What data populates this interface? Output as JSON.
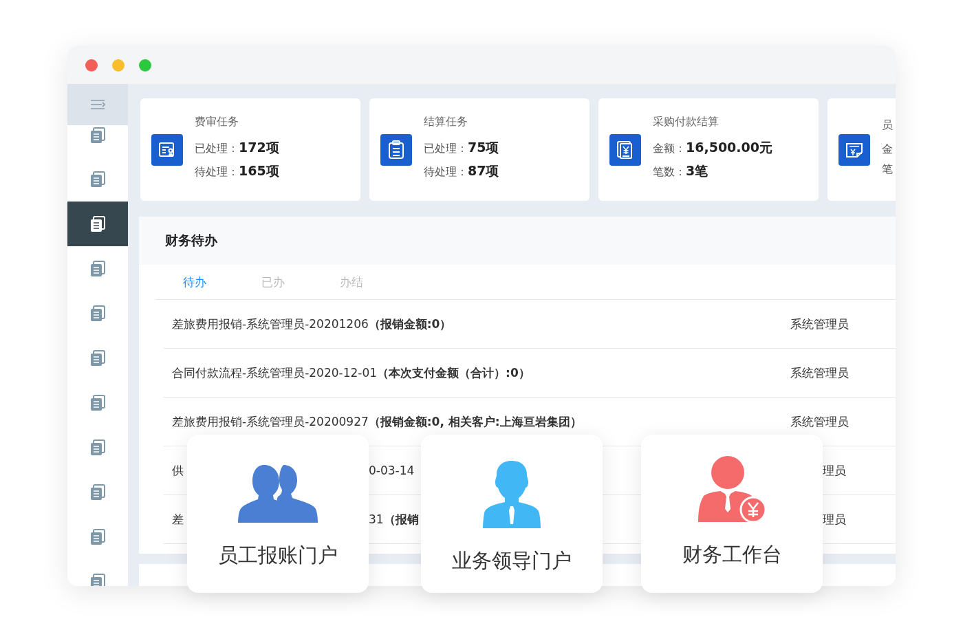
{
  "window": {
    "controls": [
      {
        "color": "#f25f58"
      },
      {
        "color": "#f9be2e"
      },
      {
        "color": "#2cc840"
      }
    ]
  },
  "sidebar": {
    "items": [
      {
        "selected": false
      },
      {
        "selected": false
      },
      {
        "selected": true
      },
      {
        "selected": false
      },
      {
        "selected": false
      },
      {
        "selected": false
      },
      {
        "selected": false
      },
      {
        "selected": false
      },
      {
        "selected": false
      },
      {
        "selected": false
      },
      {
        "selected": false
      }
    ]
  },
  "stats": [
    {
      "title": "费审任务",
      "kind": "review",
      "lines": [
        {
          "label": "已处理：",
          "value": "172项"
        },
        {
          "label": "待处理：",
          "value": "165项"
        }
      ]
    },
    {
      "title": "结算任务",
      "kind": "clipboard",
      "lines": [
        {
          "label": "已处理：",
          "value": "75项"
        },
        {
          "label": "待处理：",
          "value": "87项"
        }
      ]
    },
    {
      "title": "采购付款结算",
      "kind": "payment",
      "lines": [
        {
          "label": "金额：",
          "value": "16,500.00元"
        },
        {
          "label": "笔数：",
          "value": "3笔"
        }
      ]
    },
    {
      "title": "员",
      "kind": "expense",
      "lines": [
        {
          "label": "金"
        },
        {
          "label": "笔"
        }
      ]
    }
  ],
  "todo": {
    "title": "财务待办",
    "tabs": [
      {
        "label": "待办",
        "selected": true
      },
      {
        "label": "已办",
        "selected": false
      },
      {
        "label": "办结",
        "selected": false
      }
    ],
    "rows": [
      {
        "kind": "full",
        "title": "差旅费用报销-系统管理员-20201206**（报销金额:0）**",
        "owner": "系统管理员"
      },
      {
        "kind": "full",
        "title": "合同付款流程-系统管理员-2020-12-01**（本次支付金额（合计）:0）**",
        "owner": "系统管理员"
      },
      {
        "kind": "full",
        "title": "差旅费用报销-系统管理员-20200927**（报销金额:0, 相关客户:上海亘岩集团）**",
        "owner": "系统管理员"
      },
      {
        "kind": "partial",
        "fragments": [
          "供",
          "0-03-14",
          "理员"
        ]
      },
      {
        "kind": "partial",
        "fragments": [
          "差",
          "31**（报销**",
          "理员"
        ]
      }
    ]
  },
  "portals": [
    {
      "title": "员工报账门户",
      "kind": "employee"
    },
    {
      "title": "业务领导门户",
      "kind": "leader"
    },
    {
      "title": "财务工作台",
      "kind": "finance"
    }
  ]
}
